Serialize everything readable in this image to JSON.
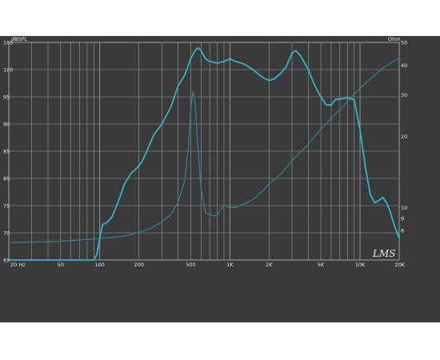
{
  "chart_data": {
    "type": "line",
    "title": "",
    "x_scale": "log",
    "xlim": [
      20,
      20000
    ],
    "y_left": {
      "label": "dBSPL",
      "lim": [
        65,
        105
      ]
    },
    "y_right": {
      "label": "Ohm",
      "scale": "log",
      "lim": [
        6,
        50
      ]
    },
    "x_tick_labels": [
      {
        "v": 20,
        "t": "20 Hz"
      },
      {
        "v": 50,
        "t": "50"
      },
      {
        "v": 100,
        "t": "100"
      },
      {
        "v": 200,
        "t": "200"
      },
      {
        "v": 500,
        "t": "500"
      },
      {
        "v": 1000,
        "t": "1K"
      },
      {
        "v": 2000,
        "t": "2K"
      },
      {
        "v": 5000,
        "t": "5K"
      },
      {
        "v": 10000,
        "t": "10K"
      },
      {
        "v": 20000,
        "t": "20K"
      }
    ],
    "y_left_ticks": [
      65,
      70,
      75,
      80,
      85,
      90,
      95,
      100,
      105
    ],
    "y_right_ticks": [
      8,
      9,
      10,
      20,
      30,
      40,
      50
    ],
    "grid": true,
    "logo_text": "LMS",
    "colors": {
      "spl": "#29b8c8",
      "impedance": "#2f8590",
      "grid": "#9a9a9a",
      "background": "#3a3a3a"
    },
    "series": [
      {
        "axis": "left",
        "points": [
          [
            20,
            65
          ],
          [
            50,
            65
          ],
          [
            90,
            65
          ],
          [
            95,
            66
          ],
          [
            100,
            69
          ],
          [
            105,
            71.5
          ],
          [
            115,
            72
          ],
          [
            125,
            73
          ],
          [
            140,
            76
          ],
          [
            155,
            79
          ],
          [
            175,
            81
          ],
          [
            195,
            82
          ],
          [
            210,
            83
          ],
          [
            230,
            85
          ],
          [
            260,
            88
          ],
          [
            300,
            90
          ],
          [
            350,
            93
          ],
          [
            400,
            97
          ],
          [
            450,
            99
          ],
          [
            500,
            102
          ],
          [
            540,
            103.5
          ],
          [
            570,
            104
          ],
          [
            600,
            103.5
          ],
          [
            650,
            102
          ],
          [
            700,
            101.5
          ],
          [
            800,
            101.2
          ],
          [
            900,
            101.5
          ],
          [
            1000,
            102
          ],
          [
            1100,
            101.5
          ],
          [
            1300,
            101
          ],
          [
            1500,
            100
          ],
          [
            1800,
            98.5
          ],
          [
            2000,
            98
          ],
          [
            2200,
            98.3
          ],
          [
            2500,
            99.5
          ],
          [
            2700,
            100.5
          ],
          [
            3000,
            103
          ],
          [
            3200,
            103.5
          ],
          [
            3500,
            102.5
          ],
          [
            4000,
            100
          ],
          [
            4500,
            97
          ],
          [
            5000,
            95
          ],
          [
            5500,
            93.5
          ],
          [
            6000,
            93.5
          ],
          [
            6500,
            94.5
          ],
          [
            8000,
            94.8
          ],
          [
            9000,
            94.5
          ],
          [
            10000,
            89
          ],
          [
            11000,
            82
          ],
          [
            12000,
            77
          ],
          [
            13000,
            75.5
          ],
          [
            14000,
            76
          ],
          [
            15000,
            76.5
          ],
          [
            16000,
            75.5
          ],
          [
            17000,
            74
          ],
          [
            18000,
            72
          ],
          [
            20000,
            69
          ]
        ]
      },
      {
        "axis": "right",
        "points": [
          [
            20,
            7.1
          ],
          [
            50,
            7.2
          ],
          [
            100,
            7.4
          ],
          [
            150,
            7.55
          ],
          [
            200,
            7.85
          ],
          [
            250,
            8.2
          ],
          [
            300,
            8.7
          ],
          [
            350,
            9.3
          ],
          [
            400,
            10.5
          ],
          [
            450,
            13
          ],
          [
            480,
            18
          ],
          [
            500,
            26
          ],
          [
            520,
            31
          ],
          [
            540,
            28
          ],
          [
            560,
            20
          ],
          [
            600,
            12
          ],
          [
            650,
            9.5
          ],
          [
            700,
            9.3
          ],
          [
            750,
            9.2
          ],
          [
            800,
            9.3
          ],
          [
            850,
            9.8
          ],
          [
            900,
            10.2
          ],
          [
            950,
            10.1
          ],
          [
            1000,
            10.0
          ],
          [
            1100,
            10.0
          ],
          [
            1300,
            10.4
          ],
          [
            1500,
            10.8
          ],
          [
            1800,
            11.8
          ],
          [
            2000,
            12.6
          ],
          [
            2500,
            14
          ],
          [
            3000,
            15.8
          ],
          [
            4000,
            18.5
          ],
          [
            5000,
            21.5
          ],
          [
            7000,
            26
          ],
          [
            10000,
            32
          ],
          [
            15000,
            39
          ],
          [
            20000,
            43
          ]
        ]
      }
    ]
  }
}
